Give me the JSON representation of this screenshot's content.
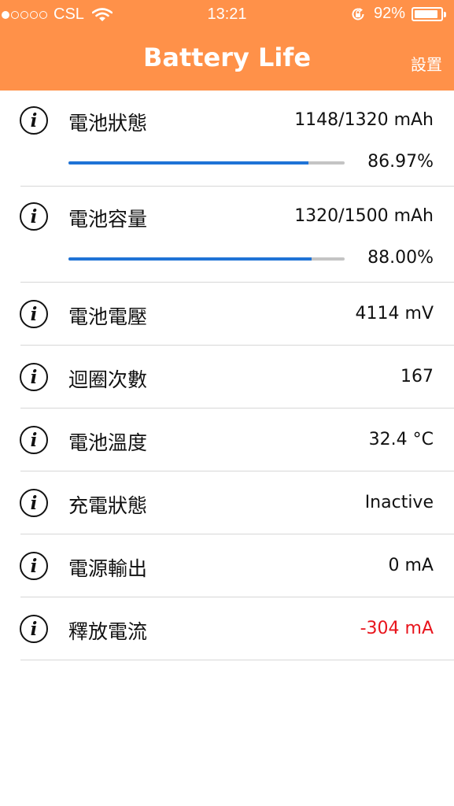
{
  "status_bar": {
    "signal_dots": [
      true,
      false,
      false,
      false,
      false
    ],
    "carrier": "CSL",
    "time": "13:21",
    "battery_percent": "92%",
    "battery_level": 0.92
  },
  "nav": {
    "title": "Battery Life",
    "settings_label": "設置"
  },
  "colors": {
    "header": "#ff9149",
    "progress": "#1f73d6",
    "negative": "#e8141c"
  },
  "rows": [
    {
      "label": "電池狀態",
      "value": "1148/1320 mAh",
      "percent_text": "86.97%",
      "progress": 0.8697
    },
    {
      "label": "電池容量",
      "value": "1320/1500 mAh",
      "percent_text": "88.00%",
      "progress": 0.88
    },
    {
      "label": "電池電壓",
      "value": "4114 mV"
    },
    {
      "label": "迴圈次數",
      "value": "167"
    },
    {
      "label": "電池溫度",
      "value": "32.4 °C"
    },
    {
      "label": "充電狀態",
      "value": "Inactive"
    },
    {
      "label": "電源輸出",
      "value": "0 mA"
    },
    {
      "label": "釋放電流",
      "value": "-304 mA",
      "negative": true
    }
  ]
}
